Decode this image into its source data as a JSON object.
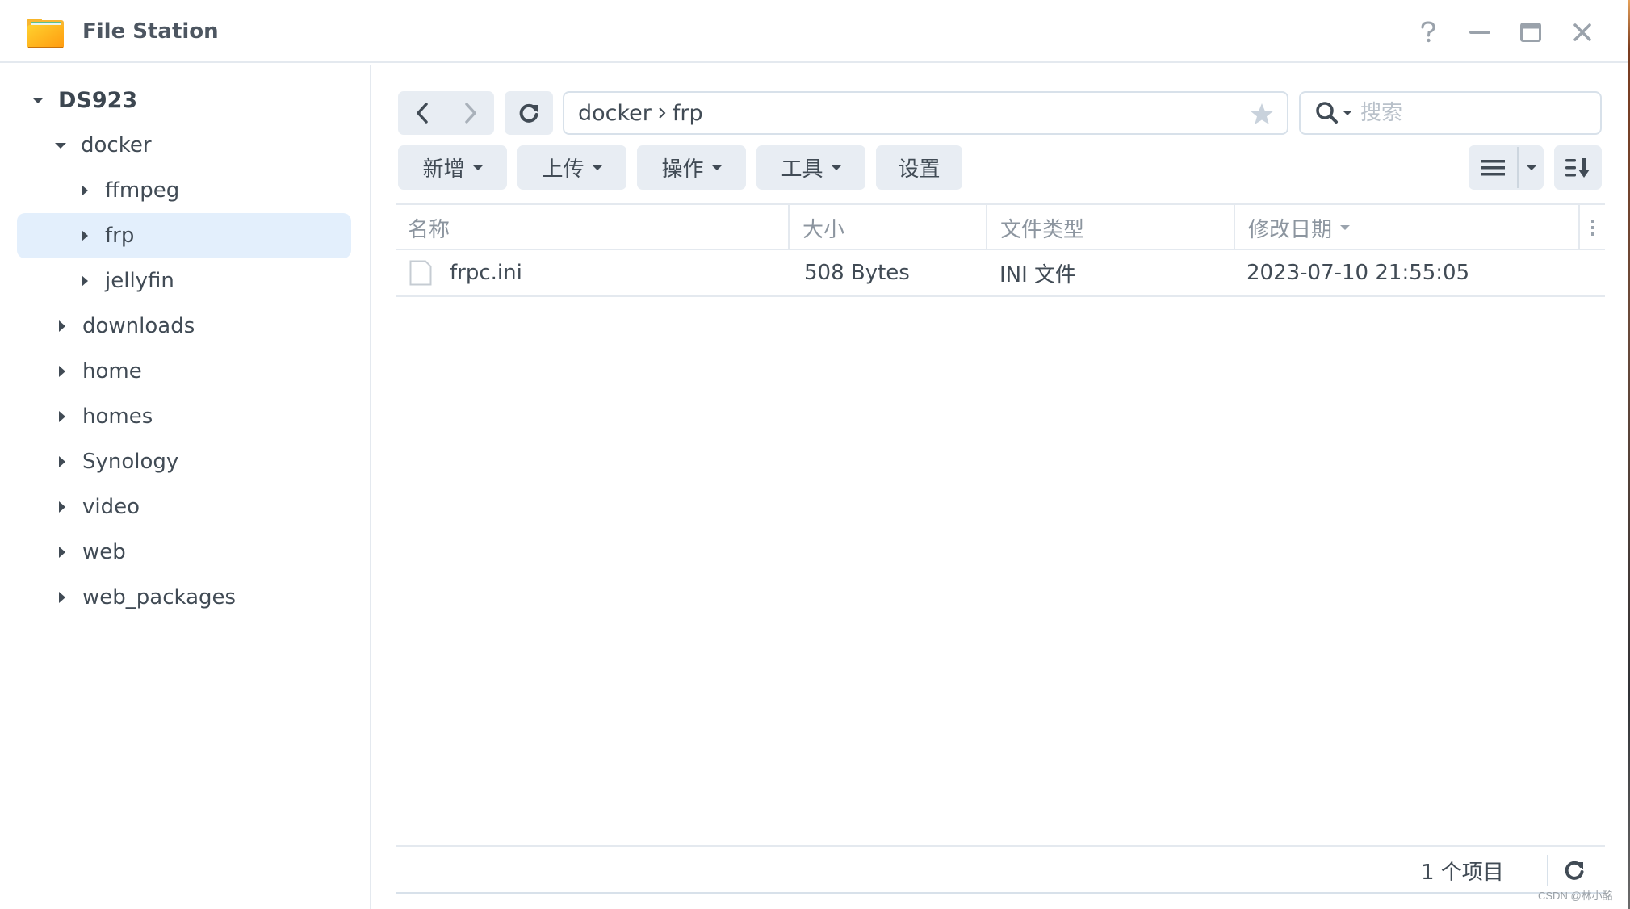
{
  "window": {
    "title": "File Station",
    "controls": [
      "help",
      "minimize",
      "maximize",
      "close"
    ]
  },
  "sidebar": {
    "root": {
      "label": "DS923",
      "expanded": true
    },
    "items": [
      {
        "label": "docker",
        "level": 1,
        "expanded": true,
        "selected": false
      },
      {
        "label": "ffmpeg",
        "level": 2,
        "expanded": false,
        "selected": false
      },
      {
        "label": "frp",
        "level": 2,
        "expanded": false,
        "selected": true
      },
      {
        "label": "jellyfin",
        "level": 2,
        "expanded": false,
        "selected": false
      },
      {
        "label": "downloads",
        "level": 1,
        "expanded": false,
        "selected": false
      },
      {
        "label": "home",
        "level": 1,
        "expanded": false,
        "selected": false
      },
      {
        "label": "homes",
        "level": 1,
        "expanded": false,
        "selected": false
      },
      {
        "label": "Synology",
        "level": 1,
        "expanded": false,
        "selected": false
      },
      {
        "label": "video",
        "level": 1,
        "expanded": false,
        "selected": false
      },
      {
        "label": "web",
        "level": 1,
        "expanded": false,
        "selected": false
      },
      {
        "label": "web_packages",
        "level": 1,
        "expanded": false,
        "selected": false
      }
    ]
  },
  "toolbar": {
    "path": [
      "docker",
      "frp"
    ],
    "search_placeholder": "搜索",
    "actions": [
      {
        "label": "新增",
        "has_dropdown": true
      },
      {
        "label": "上传",
        "has_dropdown": true
      },
      {
        "label": "操作",
        "has_dropdown": true
      },
      {
        "label": "工具",
        "has_dropdown": true
      },
      {
        "label": "设置",
        "has_dropdown": false
      }
    ],
    "icons": {
      "back": "chevron-left-icon",
      "forward": "chevron-right-icon",
      "refresh": "refresh-icon",
      "favorite": "star-icon",
      "search": "search-icon",
      "view": "list-view-icon",
      "sort": "sort-icon"
    }
  },
  "table": {
    "columns": [
      {
        "label": "名称",
        "sorted": false
      },
      {
        "label": "大小",
        "sorted": false
      },
      {
        "label": "文件类型",
        "sorted": false
      },
      {
        "label": "修改日期",
        "sorted": true
      }
    ],
    "rows": [
      {
        "name": "frpc.ini",
        "size": "508 Bytes",
        "type": "INI 文件",
        "modified": "2023-07-10 21:55:05"
      }
    ]
  },
  "footer": {
    "item_count": "1 个项目"
  },
  "watermark": "CSDN @林小酩",
  "colors": {
    "selected_bg": "#e3effc",
    "button_bg": "#e8edf3",
    "text": "#414b55",
    "muted_text": "#8c959f",
    "folder_icon": "#ffa516"
  }
}
